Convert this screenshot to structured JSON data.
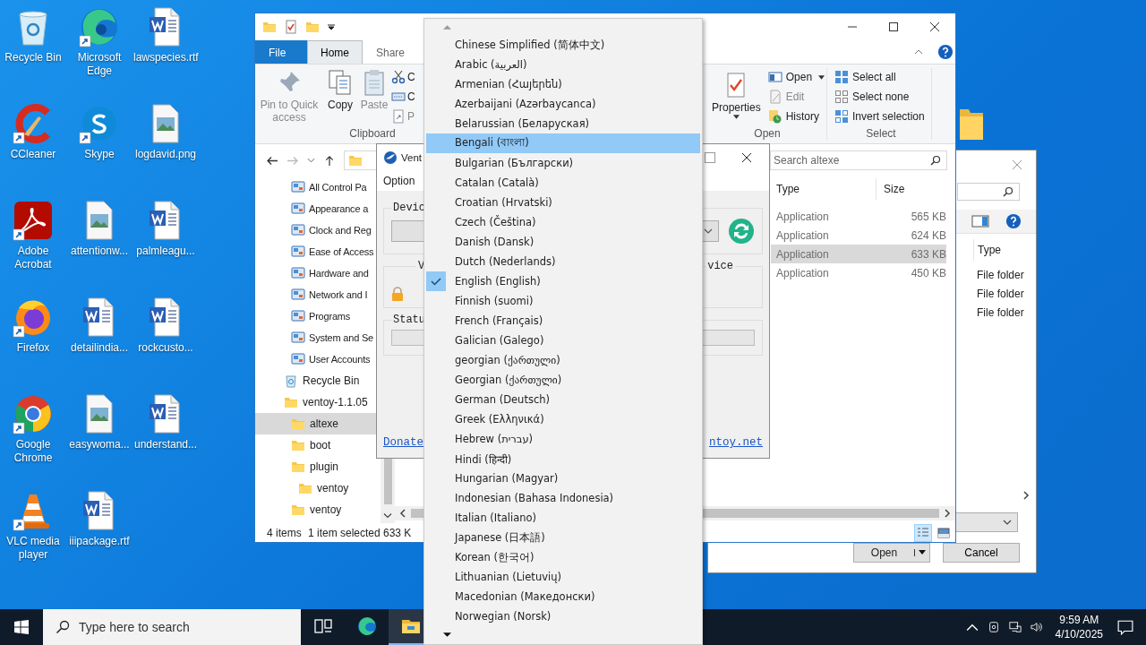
{
  "desktop_icons": [
    {
      "label": "Recycle Bin",
      "kind": "recycle",
      "shortcut": false
    },
    {
      "label": "CCleaner",
      "kind": "ccleaner",
      "shortcut": true
    },
    {
      "label": "Adobe Acrobat",
      "kind": "acrobat",
      "shortcut": true
    },
    {
      "label": "Firefox",
      "kind": "firefox",
      "shortcut": true
    },
    {
      "label": "Google Chrome",
      "kind": "chrome",
      "shortcut": true
    },
    {
      "label": "VLC media player",
      "kind": "vlc",
      "shortcut": true
    },
    {
      "label": "Microsoft Edge",
      "kind": "edge",
      "shortcut": true
    },
    {
      "label": "Skype",
      "kind": "skype",
      "shortcut": true
    },
    {
      "label": "attentionw...",
      "kind": "image",
      "shortcut": false
    },
    {
      "label": "detailindia...",
      "kind": "word",
      "shortcut": false
    },
    {
      "label": "easywoma...",
      "kind": "image",
      "shortcut": false
    },
    {
      "label": "iiipackage.rtf",
      "kind": "word",
      "shortcut": false
    },
    {
      "label": "lawspecies.rtf",
      "kind": "word",
      "shortcut": false
    },
    {
      "label": "logdavid.png",
      "kind": "image",
      "shortcut": false
    },
    {
      "label": "palmleagu...",
      "kind": "word",
      "shortcut": false
    },
    {
      "label": "rockcusto...",
      "kind": "word",
      "shortcut": false
    },
    {
      "label": "understand...",
      "kind": "word",
      "shortcut": false
    }
  ],
  "explorer": {
    "tabs": [
      {
        "label": "File",
        "kind": "file"
      },
      {
        "label": "Home",
        "kind": "tab",
        "selected": true
      },
      {
        "label": "Share",
        "kind": "tab",
        "selected": false
      }
    ],
    "clipboard": {
      "large_buttons": [
        {
          "label": "Pin to Quick access",
          "kind": "pin",
          "disabled": true
        },
        {
          "label": "Copy",
          "kind": "copy",
          "disabled": false
        },
        {
          "label": "Paste",
          "kind": "paste",
          "disabled": true
        }
      ],
      "small_buttons": [
        {
          "label": "C",
          "kind": "cut",
          "disabled": false
        },
        {
          "label": "C",
          "kind": "copypath",
          "disabled": false
        },
        {
          "label": "P",
          "kind": "shortcut",
          "disabled": true
        }
      ],
      "group_label": "Clipboard"
    },
    "open_group": {
      "large_button": "Properties",
      "items": [
        {
          "label": "Open",
          "kind": "open",
          "disabled": false
        },
        {
          "label": "Edit",
          "kind": "edit",
          "disabled": true
        },
        {
          "label": "History",
          "kind": "history",
          "disabled": false
        }
      ],
      "group_label": "Open"
    },
    "select_group": {
      "items": [
        {
          "label": "Select all",
          "kind": "all"
        },
        {
          "label": "Select none",
          "kind": "none"
        },
        {
          "label": "Invert selection",
          "kind": "invert"
        }
      ],
      "group_label": "Select"
    },
    "control_panel_items": [
      {
        "label": "All Control Pa"
      },
      {
        "label": "Appearance a"
      },
      {
        "label": "Clock and Reg"
      },
      {
        "label": "Ease of Access"
      },
      {
        "label": "Hardware and"
      },
      {
        "label": "Network and I"
      },
      {
        "label": "Programs"
      },
      {
        "label": "System and Se"
      },
      {
        "label": "User Accounts"
      }
    ],
    "tree": [
      {
        "label": "Recycle Bin",
        "kind": "recycle",
        "selected": false
      },
      {
        "label": "ventoy-1.1.05",
        "kind": "folder",
        "selected": false,
        "children": [
          {
            "label": "altexe",
            "kind": "folder",
            "selected": true
          },
          {
            "label": "boot",
            "kind": "folder",
            "selected": false
          },
          {
            "label": "plugin",
            "kind": "folder",
            "selected": false,
            "children": [
              {
                "label": "ventoy",
                "kind": "folder",
                "selected": false
              }
            ]
          },
          {
            "label": "ventoy",
            "kind": "folder",
            "selected": false
          }
        ]
      }
    ],
    "search": {
      "placeholder": "Search altexe"
    },
    "columns": [
      "Type",
      "Size"
    ],
    "rows": [
      {
        "type": "Application",
        "size": "565 KB",
        "selected": false
      },
      {
        "type": "Application",
        "size": "624 KB",
        "selected": false
      },
      {
        "type": "Application",
        "size": "633 KB",
        "selected": true
      },
      {
        "type": "Application",
        "size": "450 KB",
        "selected": false
      }
    ],
    "status": {
      "count": "4 items",
      "selection": "1 item selected",
      "size": "633 K"
    }
  },
  "ventoy": {
    "title": "Vent",
    "menu": [
      "Option"
    ],
    "device_label": "Devic",
    "package_label": "V",
    "device_right_label": "vice",
    "status_label": "Statu",
    "status_progress": {
      "level": 0
    },
    "links": [
      "Donate",
      "ntoy.net"
    ]
  },
  "language_menu": {
    "items": [
      {
        "label": "Chinese Simplified (简体中文)",
        "checked": false,
        "selected": false
      },
      {
        "label": "Arabic (العربية)",
        "checked": false,
        "selected": false
      },
      {
        "label": "Armenian (Հայերեն)",
        "checked": false,
        "selected": false
      },
      {
        "label": "Azerbaijani (Azərbaycanca)",
        "checked": false,
        "selected": false
      },
      {
        "label": "Belarussian (Беларуская)",
        "checked": false,
        "selected": false
      },
      {
        "label": "Bengali (বাংলা)",
        "checked": false,
        "selected": true
      },
      {
        "label": "Bulgarian (Български)",
        "checked": false,
        "selected": false
      },
      {
        "label": "Catalan (Català)",
        "checked": false,
        "selected": false
      },
      {
        "label": "Croatian (Hrvatski)",
        "checked": false,
        "selected": false
      },
      {
        "label": "Czech (Čeština)",
        "checked": false,
        "selected": false
      },
      {
        "label": "Danish (Dansk)",
        "checked": false,
        "selected": false
      },
      {
        "label": "Dutch (Nederlands)",
        "checked": false,
        "selected": false
      },
      {
        "label": "English (English)",
        "checked": true,
        "selected": false
      },
      {
        "label": "Finnish (suomi)",
        "checked": false,
        "selected": false
      },
      {
        "label": "French (Français)",
        "checked": false,
        "selected": false
      },
      {
        "label": "Galician (Galego)",
        "checked": false,
        "selected": false
      },
      {
        "label": "georgian (ქართული)",
        "checked": false,
        "selected": false
      },
      {
        "label": "Georgian (ქართული)",
        "checked": false,
        "selected": false
      },
      {
        "label": "German (Deutsch)",
        "checked": false,
        "selected": false
      },
      {
        "label": "Greek (Ελληνικά)",
        "checked": false,
        "selected": false
      },
      {
        "label": "Hebrew (עברית)",
        "checked": false,
        "selected": false
      },
      {
        "label": "Hindi (हिन्दी)",
        "checked": false,
        "selected": false
      },
      {
        "label": "Hungarian (Magyar)",
        "checked": false,
        "selected": false
      },
      {
        "label": "Indonesian (Bahasa Indonesia)",
        "checked": false,
        "selected": false
      },
      {
        "label": "Italian (Italiano)",
        "checked": false,
        "selected": false
      },
      {
        "label": "Japanese (日本語)",
        "checked": false,
        "selected": false
      },
      {
        "label": "Korean (한국어)",
        "checked": false,
        "selected": false
      },
      {
        "label": "Lithuanian (Lietuvių)",
        "checked": false,
        "selected": false
      },
      {
        "label": "Macedonian (Македонски)",
        "checked": false,
        "selected": false
      },
      {
        "label": "Norwegian (Norsk)",
        "checked": false,
        "selected": false
      }
    ]
  },
  "file_dialog": {
    "columns": [
      "Type"
    ],
    "rows": [
      "File folder",
      "File folder",
      "File folder"
    ],
    "buttons": [
      {
        "label": "Open",
        "kind": "split"
      },
      {
        "label": "Cancel",
        "kind": "plain"
      }
    ]
  },
  "taskbar": {
    "search_placeholder": "Type here to search",
    "apps": [
      {
        "kind": "taskview",
        "active": false
      },
      {
        "kind": "edge",
        "active": false
      },
      {
        "kind": "explorer",
        "active": true
      }
    ],
    "time": "9:59 AM",
    "date": "4/10/2025"
  }
}
